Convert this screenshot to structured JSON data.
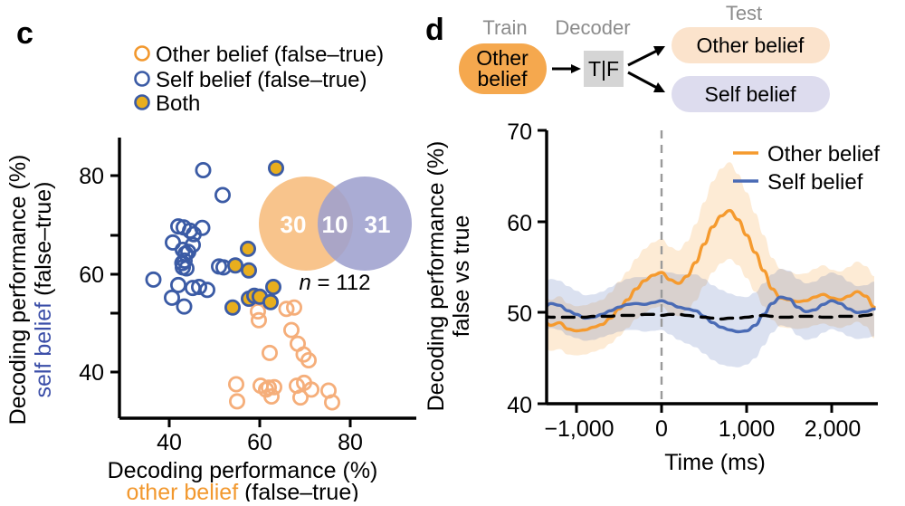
{
  "figure": {
    "top_cutoff_text": "",
    "panels": [
      {
        "letter": "c"
      },
      {
        "letter": "d"
      }
    ]
  },
  "panel_c": {
    "letter": "c",
    "legend": {
      "items": [
        {
          "label": "Other belief (false–true)",
          "marker": "open-circle",
          "color": "#F2982E"
        },
        {
          "label": "Self belief (false–true)",
          "marker": "open-circle",
          "color": "#3B5BA5"
        },
        {
          "label": "Both",
          "marker": "filled-circle",
          "fill": "#E8AE1E",
          "stroke": "#3B5BA5"
        }
      ]
    },
    "axes": {
      "x_title_line1": "Decoding performance (%)",
      "x_title_line2_colored": "other belief",
      "x_title_line2_rest": " (false–true)",
      "x_title_color": "#F2982E",
      "y_title_line1": "Decoding performance (%)",
      "y_title_line2_colored": "self belief",
      "y_title_line2_rest": " (false–true)",
      "y_title_color": "#3B4EA8",
      "x_ticks": [
        "40",
        "60",
        "80"
      ],
      "y_ticks": [
        "40",
        "60",
        "80"
      ],
      "xlim": [
        30,
        90
      ],
      "ylim": [
        30,
        88
      ]
    },
    "venn": {
      "left_count": "30",
      "overlap_count": "10",
      "right_count": "31",
      "left_color": "#F8C48C",
      "right_color": "#9EA0CE",
      "n_label_italic": "n",
      "n_label_rest": " = 112"
    },
    "chart_data": {
      "type": "scatter",
      "title": "",
      "xlabel": "Decoding performance (%) other belief (false–true)",
      "ylabel": "Decoding performance (%) self belief (false–true)",
      "xlim": [
        30,
        90
      ],
      "ylim": [
        30,
        88
      ],
      "grid": false,
      "series": [
        {
          "name": "Self belief (false–true)",
          "marker": "open-circle",
          "color": "#3B5BA5",
          "points": [
            [
              47.5,
              81.3
            ],
            [
              51.8,
              76.2
            ],
            [
              42.0,
              69.8
            ],
            [
              43.2,
              69.6
            ],
            [
              44.6,
              68.9
            ],
            [
              45.4,
              68.2
            ],
            [
              47.3,
              69.5
            ],
            [
              40.8,
              66.5
            ],
            [
              43.0,
              65.0
            ],
            [
              43.6,
              64.2
            ],
            [
              44.2,
              64.6
            ],
            [
              45.2,
              66.0
            ],
            [
              42.9,
              62.3
            ],
            [
              43.4,
              62.8
            ],
            [
              43.0,
              61.4
            ],
            [
              43.8,
              61.2
            ],
            [
              51.0,
              61.6
            ],
            [
              52.0,
              61.4
            ],
            [
              36.5,
              58.9
            ],
            [
              42.0,
              57.8
            ],
            [
              45.2,
              57.2
            ],
            [
              46.6,
              57.4
            ],
            [
              48.4,
              56.8
            ],
            [
              40.6,
              55.2
            ],
            [
              43.3,
              53.4
            ]
          ]
        },
        {
          "name": "Other belief (false–true)",
          "marker": "open-circle",
          "color": "#F5AE7A",
          "points": [
            [
              59.6,
              52.4
            ],
            [
              59.8,
              50.6
            ],
            [
              65.9,
              52.9
            ],
            [
              67.6,
              53.2
            ],
            [
              67.0,
              48.6
            ],
            [
              68.4,
              45.8
            ],
            [
              69.7,
              43.6
            ],
            [
              70.8,
              42.4
            ],
            [
              62.2,
              43.9
            ],
            [
              54.8,
              37.5
            ],
            [
              55.0,
              34.0
            ],
            [
              60.2,
              37.2
            ],
            [
              61.4,
              36.4
            ],
            [
              62.0,
              36.8
            ],
            [
              62.6,
              35.0
            ],
            [
              63.2,
              36.9
            ],
            [
              68.2,
              37.2
            ],
            [
              69.8,
              37.8
            ],
            [
              69.0,
              34.8
            ],
            [
              71.4,
              36.4
            ],
            [
              75.2,
              36.2
            ],
            [
              76.0,
              33.8
            ]
          ]
        },
        {
          "name": "Both",
          "marker": "filled-circle",
          "fill": "#E8AE1E",
          "stroke": "#3B5BA5",
          "points": [
            [
              63.6,
              81.7
            ],
            [
              57.4,
              65.2
            ],
            [
              54.6,
              61.8
            ],
            [
              57.6,
              60.8
            ],
            [
              63.0,
              57.4
            ],
            [
              54.0,
              53.2
            ],
            [
              57.6,
              55.0
            ],
            [
              58.8,
              55.6
            ],
            [
              60.0,
              55.4
            ],
            [
              62.4,
              54.3
            ]
          ]
        }
      ]
    }
  },
  "panel_d": {
    "letter": "d",
    "flow": {
      "train_label": "Train",
      "decoder_label": "Decoder",
      "test_label": "Test",
      "train_pill_line1": "Other",
      "train_pill_line2": "belief",
      "train_pill_color": "#F5A84E",
      "decoder_box_label": "T|F",
      "decoder_box_color": "#D5D5D5",
      "test_pill_1": "Other belief",
      "test_pill_1_color": "#FBE3CC",
      "test_pill_2": "Self belief",
      "test_pill_2_color": "#DDDCEE"
    },
    "axes": {
      "y_title_line1": "Decoding performance (%)",
      "y_title_line2": "false vs true",
      "x_title": "Time (ms)",
      "y_ticks": [
        "70",
        "60",
        "50",
        "40"
      ],
      "x_ticks": [
        "−1,000",
        "0",
        "1,000",
        "2,000"
      ]
    },
    "legend": {
      "items": [
        {
          "label": "Other belief",
          "color": "#F59A2E"
        },
        {
          "label": "Self belief",
          "color": "#4A6BB5"
        }
      ]
    },
    "chart_data": {
      "type": "line",
      "title": "",
      "xlabel": "Time (ms)",
      "ylabel": "Decoding performance (%) false vs true",
      "xlim": [
        -1400,
        2500
      ],
      "ylim": [
        40,
        70
      ],
      "grid": false,
      "legend_position": "top-right",
      "event_marker_x": 0,
      "x": [
        -1400,
        -1300,
        -1200,
        -1100,
        -1000,
        -900,
        -800,
        -700,
        -600,
        -500,
        -400,
        -300,
        -200,
        -100,
        0,
        100,
        200,
        300,
        400,
        500,
        600,
        700,
        800,
        900,
        1000,
        1100,
        1200,
        1300,
        1400,
        1500,
        1600,
        1700,
        1800,
        1900,
        2000,
        2100,
        2200,
        2300,
        2400,
        2500
      ],
      "series": [
        {
          "name": "Other belief",
          "color": "#F59A2E",
          "values": [
            49.2,
            48.6,
            48.9,
            48.2,
            48.0,
            48.1,
            48.4,
            48.7,
            49.4,
            50.4,
            51.4,
            52.6,
            53.5,
            54.1,
            54.4,
            53.6,
            53.2,
            54.0,
            55.5,
            57.5,
            59.4,
            60.6,
            61.2,
            60.2,
            58.5,
            56.6,
            54.6,
            52.6,
            51.6,
            51.4,
            51.2,
            51.3,
            51.7,
            52.0,
            51.6,
            51.4,
            51.8,
            52.3,
            51.8,
            50.6
          ],
          "band_lower": [
            46.4,
            45.8,
            46.0,
            45.4,
            45.3,
            45.4,
            45.7,
            46.0,
            46.6,
            47.4,
            48.3,
            49.3,
            50.0,
            50.5,
            50.7,
            50.0,
            49.6,
            50.2,
            51.3,
            52.9,
            54.4,
            55.4,
            55.9,
            55.2,
            53.8,
            52.3,
            50.7,
            49.2,
            48.4,
            48.3,
            48.2,
            48.3,
            48.6,
            48.8,
            48.5,
            48.3,
            48.6,
            49.0,
            48.5,
            47.2
          ],
          "band_upper": [
            52.0,
            51.4,
            51.8,
            51.0,
            50.7,
            50.8,
            51.1,
            51.4,
            52.2,
            53.4,
            54.5,
            55.9,
            57.0,
            57.7,
            58.1,
            57.2,
            56.8,
            57.8,
            59.7,
            62.1,
            64.4,
            65.8,
            66.5,
            65.2,
            63.2,
            60.9,
            58.5,
            56.0,
            54.8,
            54.5,
            54.2,
            54.3,
            54.8,
            55.2,
            54.7,
            54.5,
            55.0,
            55.6,
            55.1,
            54.0
          ]
        },
        {
          "name": "Self belief",
          "color": "#4A6BB5",
          "values": [
            50.4,
            51.0,
            50.8,
            50.2,
            49.8,
            49.4,
            49.5,
            49.8,
            50.2,
            50.6,
            50.9,
            51.0,
            50.9,
            51.1,
            51.3,
            51.0,
            50.6,
            50.4,
            50.2,
            49.6,
            48.9,
            48.4,
            48.1,
            47.9,
            48.0,
            48.6,
            49.8,
            51.0,
            51.7,
            51.5,
            50.6,
            50.1,
            50.3,
            50.9,
            51.3,
            51.0,
            50.4,
            50.0,
            50.1,
            50.4
          ],
          "band_lower": [
            47.8,
            48.3,
            48.1,
            47.5,
            47.2,
            46.9,
            47.0,
            47.3,
            47.6,
            47.9,
            48.1,
            48.1,
            47.9,
            48.0,
            48.1,
            47.6,
            47.0,
            46.6,
            46.2,
            45.5,
            44.8,
            44.3,
            44.1,
            44.0,
            44.3,
            45.0,
            46.4,
            47.8,
            48.6,
            48.4,
            47.5,
            47.0,
            47.2,
            47.8,
            48.2,
            47.9,
            47.4,
            47.1,
            47.2,
            47.4
          ],
          "band_upper": [
            53.0,
            53.7,
            53.5,
            52.9,
            52.4,
            51.9,
            52.0,
            52.3,
            52.8,
            53.3,
            53.7,
            53.9,
            53.9,
            54.2,
            54.5,
            54.4,
            54.2,
            54.2,
            54.2,
            53.7,
            53.0,
            52.5,
            52.1,
            51.8,
            51.7,
            52.2,
            53.2,
            54.2,
            54.8,
            54.6,
            53.7,
            53.2,
            53.4,
            54.0,
            54.4,
            54.1,
            53.4,
            52.9,
            53.0,
            53.4
          ]
        },
        {
          "name": "Chance (dashed)",
          "color": "#000000",
          "style": "dashed",
          "values": [
            49.6,
            49.5,
            49.5,
            49.5,
            49.5,
            49.5,
            49.6,
            49.6,
            49.6,
            49.7,
            49.7,
            49.7,
            49.8,
            49.8,
            49.7,
            49.8,
            49.8,
            49.7,
            49.6,
            49.5,
            49.4,
            49.3,
            49.4,
            49.4,
            49.5,
            49.6,
            49.7,
            49.6,
            49.5,
            49.5,
            49.6,
            49.6,
            49.6,
            49.5,
            49.5,
            49.6,
            49.6,
            49.6,
            49.7,
            49.8
          ]
        }
      ]
    }
  }
}
